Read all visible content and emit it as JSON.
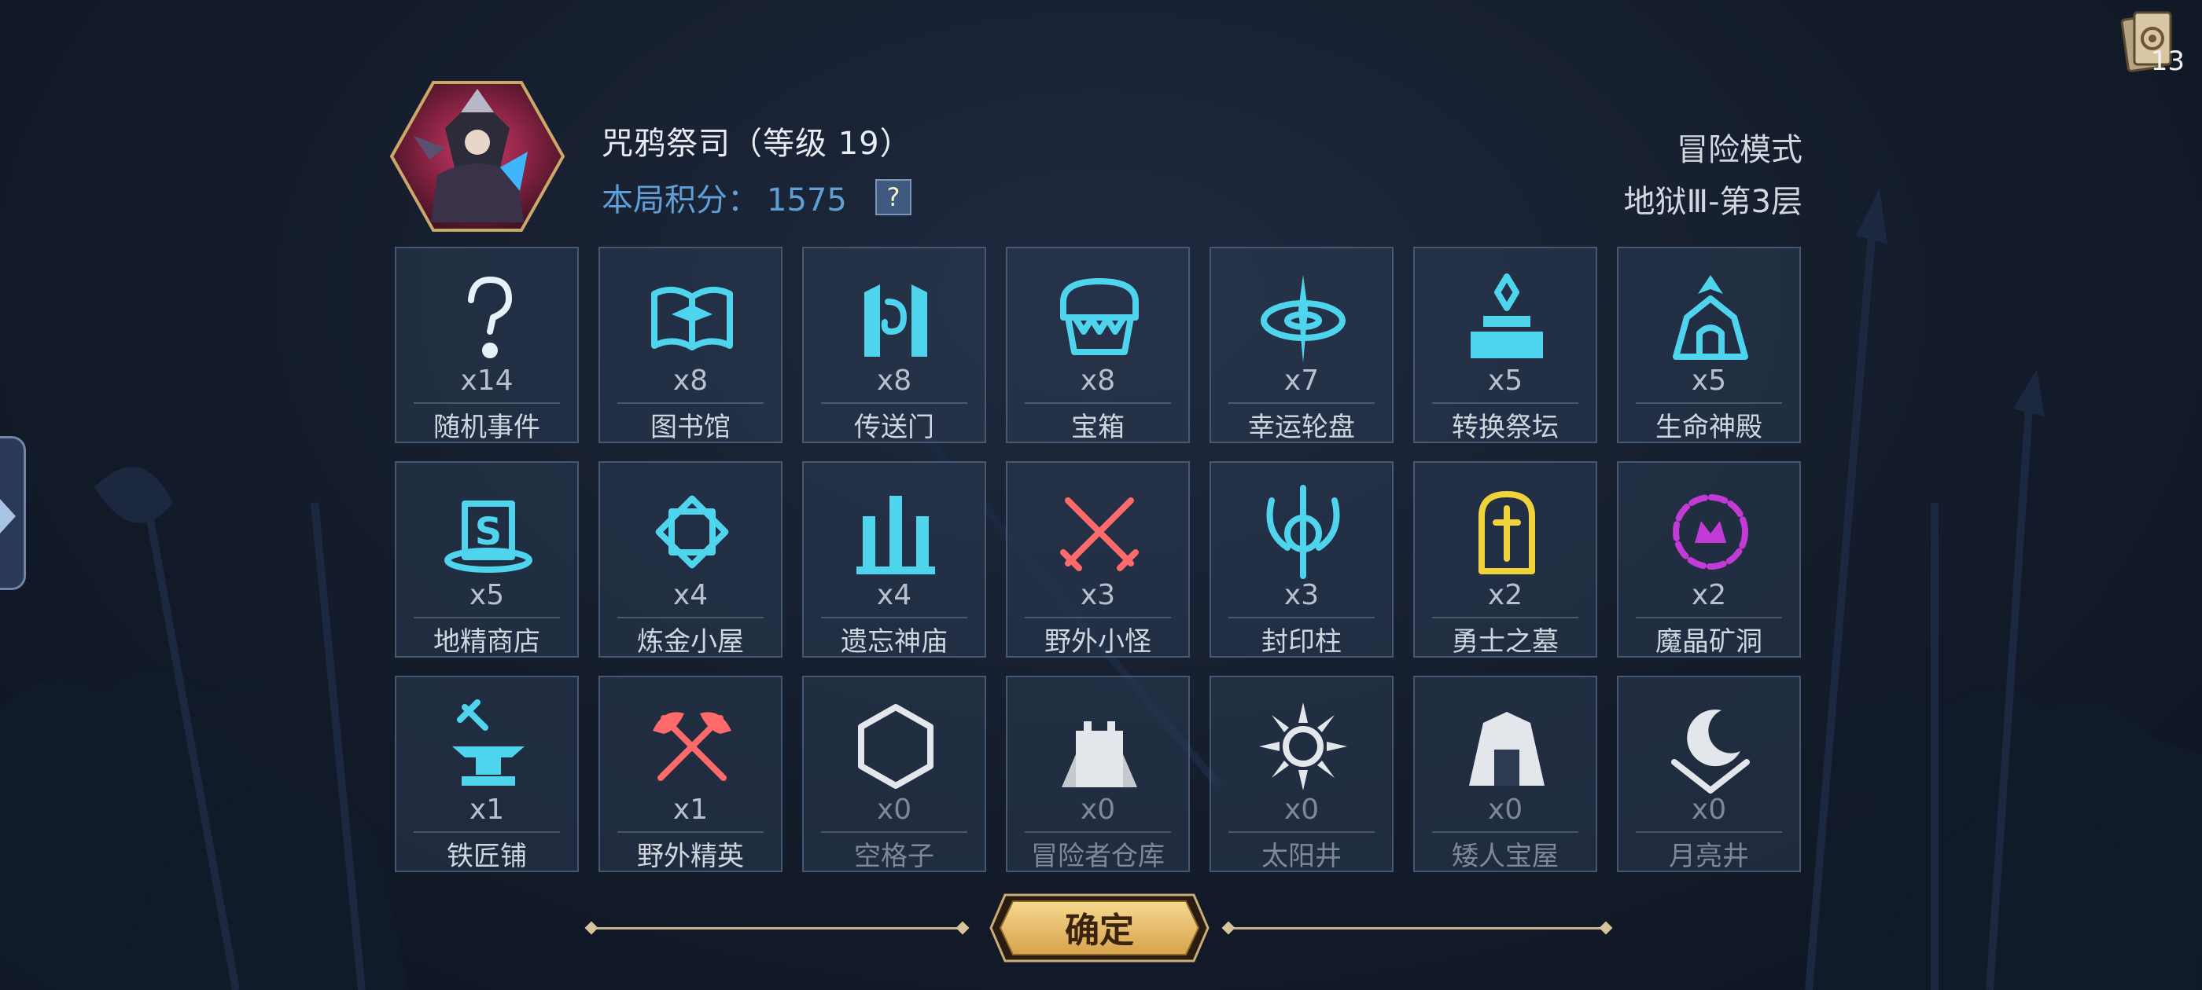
{
  "header": {
    "title": "咒鸦祭司（等级 19）",
    "score_label": "本局积分：",
    "score_value": "1575",
    "help": "?",
    "mode": "冒险模式",
    "floor": "地狱Ⅲ-第3层",
    "deck_count": "13"
  },
  "tiles": [
    {
      "icon": "question-mark-icon",
      "count": "x14",
      "name": "随机事件",
      "color": "#e6f1fa"
    },
    {
      "icon": "book-icon",
      "count": "x8",
      "name": "图书馆",
      "color": "#4fd4ee"
    },
    {
      "icon": "portal-icon",
      "count": "x8",
      "name": "传送门",
      "color": "#4fd4ee"
    },
    {
      "icon": "chest-icon",
      "count": "x8",
      "name": "宝箱",
      "color": "#4fd4ee"
    },
    {
      "icon": "wheel-icon",
      "count": "x7",
      "name": "幸运轮盘",
      "color": "#4fd4ee"
    },
    {
      "icon": "altar-icon",
      "count": "x5",
      "name": "转换祭坛",
      "color": "#4fd4ee"
    },
    {
      "icon": "temple-icon",
      "count": "x5",
      "name": "生命神殿",
      "color": "#4fd4ee"
    },
    {
      "icon": "shop-hat-icon",
      "count": "x5",
      "name": "地精商店",
      "color": "#4fd4ee"
    },
    {
      "icon": "alchemy-icon",
      "count": "x4",
      "name": "炼金小屋",
      "color": "#4fd4ee"
    },
    {
      "icon": "ruins-icon",
      "count": "x4",
      "name": "遗忘神庙",
      "color": "#4fd4ee"
    },
    {
      "icon": "crossed-swords-icon",
      "count": "x3",
      "name": "野外小怪",
      "color": "#ff6a6a"
    },
    {
      "icon": "seal-pillar-icon",
      "count": "x3",
      "name": "封印柱",
      "color": "#4fd4ee"
    },
    {
      "icon": "tomb-icon",
      "count": "x2",
      "name": "勇士之墓",
      "color": "#f0d33a"
    },
    {
      "icon": "crystal-mine-icon",
      "count": "x2",
      "name": "魔晶矿洞",
      "color": "#c33bd6"
    },
    {
      "icon": "anvil-icon",
      "count": "x1",
      "name": "铁匠铺",
      "color": "#4fd4ee"
    },
    {
      "icon": "crossed-axes-icon",
      "count": "x1",
      "name": "野外精英",
      "color": "#ff6a6a"
    },
    {
      "icon": "hexagon-icon",
      "count": "x0",
      "name": "空格子",
      "color": "#e3e6ea"
    },
    {
      "icon": "tower-icon",
      "count": "x0",
      "name": "冒险者仓库",
      "color": "#e3e6ea"
    },
    {
      "icon": "sun-icon",
      "count": "x0",
      "name": "太阳井",
      "color": "#e3e6ea"
    },
    {
      "icon": "dwarf-house-icon",
      "count": "x0",
      "name": "矮人宝屋",
      "color": "#e3e6ea"
    },
    {
      "icon": "moon-icon",
      "count": "x0",
      "name": "月亮井",
      "color": "#e3e6ea"
    }
  ],
  "confirm": {
    "label": "确定"
  }
}
